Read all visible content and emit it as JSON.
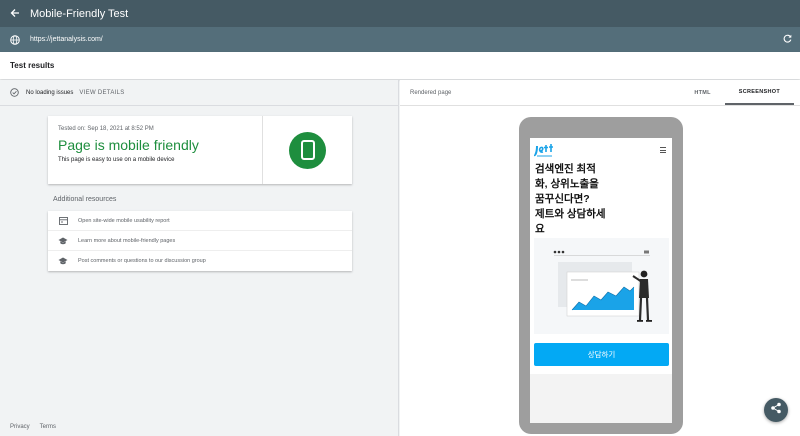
{
  "app": {
    "title": "Mobile-Friendly Test"
  },
  "url_bar": {
    "url": "https://jettanalysis.com/"
  },
  "results": {
    "label": "Test results"
  },
  "status": {
    "text": "No loading issues",
    "view_details": "VIEW DETAILS"
  },
  "card": {
    "tested_on": "Tested on: Sep 18, 2021 at 8:52 PM",
    "headline": "Page is mobile friendly",
    "subtext": "This page is easy to use on a mobile device"
  },
  "additional": {
    "title": "Additional resources",
    "items": [
      {
        "label": "Open site-wide mobile usability report",
        "icon": "report-icon"
      },
      {
        "label": "Learn more about mobile-friendly pages",
        "icon": "school-icon"
      },
      {
        "label": "Post comments or questions to our discussion group",
        "icon": "school-icon"
      }
    ]
  },
  "footer": {
    "privacy": "Privacy",
    "terms": "Terms"
  },
  "rendered": {
    "label": "Rendered page",
    "tabs": [
      "HTML",
      "SCREENSHOT"
    ],
    "active_tab": "SCREENSHOT"
  },
  "phone": {
    "headline_lines": [
      "검색엔진 최적",
      "화, 상위노출을",
      "꿈꾸신다면?",
      "제트와 상담하세",
      "요"
    ],
    "cta": "상담하기"
  },
  "colors": {
    "header": "#455a64",
    "urlbar": "#546e7a",
    "success": "#1e8e3e",
    "cta": "#03a9f4"
  }
}
